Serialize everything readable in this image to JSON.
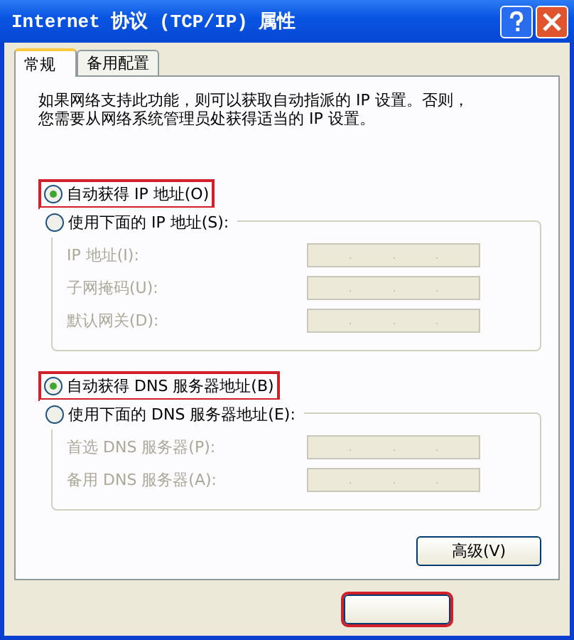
{
  "window": {
    "title": "Internet 协议 (TCP/IP) 属性"
  },
  "tabs": [
    {
      "label": "常规",
      "selected": true
    },
    {
      "label": "备用配置",
      "selected": false
    }
  ],
  "description": [
    "如果网络支持此功能，则可以获取自动指派的 IP 设置。否则，",
    "您需要从网络系统管理员处获得适当的 IP 设置。"
  ],
  "ip": {
    "auto": {
      "label": "自动获得 IP 地址(O)",
      "selected": true,
      "highlighted": true
    },
    "manual": {
      "label": "使用下面的 IP 地址(S):",
      "selected": false,
      "highlighted": false
    },
    "fields": [
      {
        "label": "IP 地址(I):",
        "disabled": true
      },
      {
        "label": "子网掩码(U):",
        "disabled": true
      },
      {
        "label": "默认网关(D):",
        "disabled": true
      }
    ]
  },
  "dns": {
    "auto": {
      "label": "自动获得 DNS 服务器地址(B)",
      "selected": true,
      "highlighted": true
    },
    "manual": {
      "label": "使用下面的 DNS 服务器地址(E):",
      "selected": false,
      "highlighted": false
    },
    "fields": [
      {
        "label": "首选 DNS 服务器(P):",
        "disabled": true
      },
      {
        "label": "备用 DNS 服务器(A):",
        "disabled": true
      }
    ]
  },
  "advanced_button": "高级(V)",
  "ok_button": {
    "highlighted": true
  }
}
